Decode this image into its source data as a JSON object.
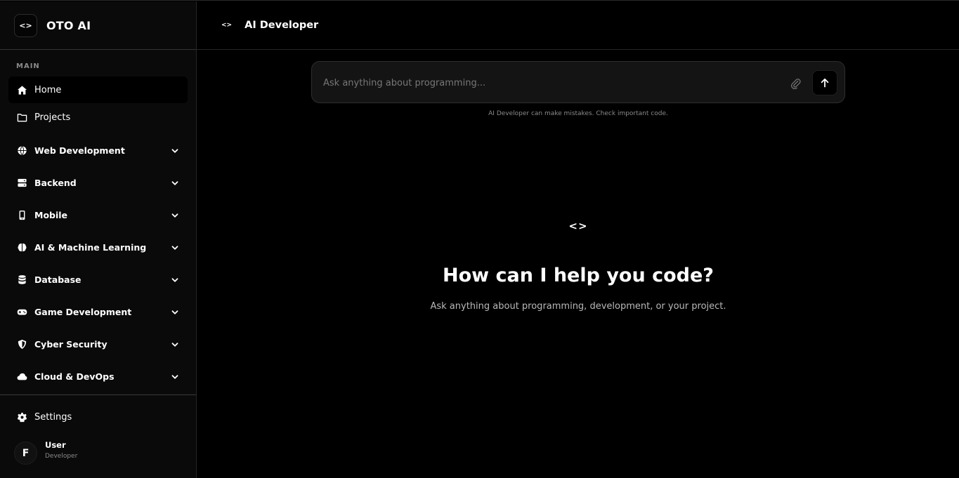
{
  "brand": {
    "logo": "<>",
    "name": "OTO AI"
  },
  "sidebar": {
    "section_label": "MAIN",
    "items": [
      {
        "label": "Home",
        "icon": "home-icon",
        "active": true,
        "expandable": false
      },
      {
        "label": "Projects",
        "icon": "folder-icon",
        "active": false,
        "expandable": false
      },
      {
        "label": "Web Development",
        "icon": "globe-icon",
        "active": false,
        "expandable": true
      },
      {
        "label": "Backend",
        "icon": "server-icon",
        "active": false,
        "expandable": true
      },
      {
        "label": "Mobile",
        "icon": "mobile-icon",
        "active": false,
        "expandable": true
      },
      {
        "label": "AI & Machine Learning",
        "icon": "brain-icon",
        "active": false,
        "expandable": true
      },
      {
        "label": "Database",
        "icon": "database-icon",
        "active": false,
        "expandable": true
      },
      {
        "label": "Game Development",
        "icon": "gamepad-icon",
        "active": false,
        "expandable": true
      },
      {
        "label": "Cyber Security",
        "icon": "shield-icon",
        "active": false,
        "expandable": true
      },
      {
        "label": "Cloud & DevOps",
        "icon": "cloud-icon",
        "active": false,
        "expandable": true
      }
    ],
    "settings_label": "Settings",
    "user": {
      "initial": "F",
      "name": "User",
      "role": "Developer"
    }
  },
  "header": {
    "icon": "<>",
    "title": "AI Developer"
  },
  "composer": {
    "placeholder": "Ask anything about programming...",
    "value": "",
    "disclaimer": "AI Developer can make mistakes. Check important code."
  },
  "hero": {
    "icon": "<>",
    "title": "How can I help you code?",
    "subtitle": "Ask anything about programming, development, or your project."
  },
  "colors": {
    "background": "#000000",
    "sidebar": "#0a0a0a",
    "text": "#ffffff",
    "muted": "#8a8a8a"
  }
}
